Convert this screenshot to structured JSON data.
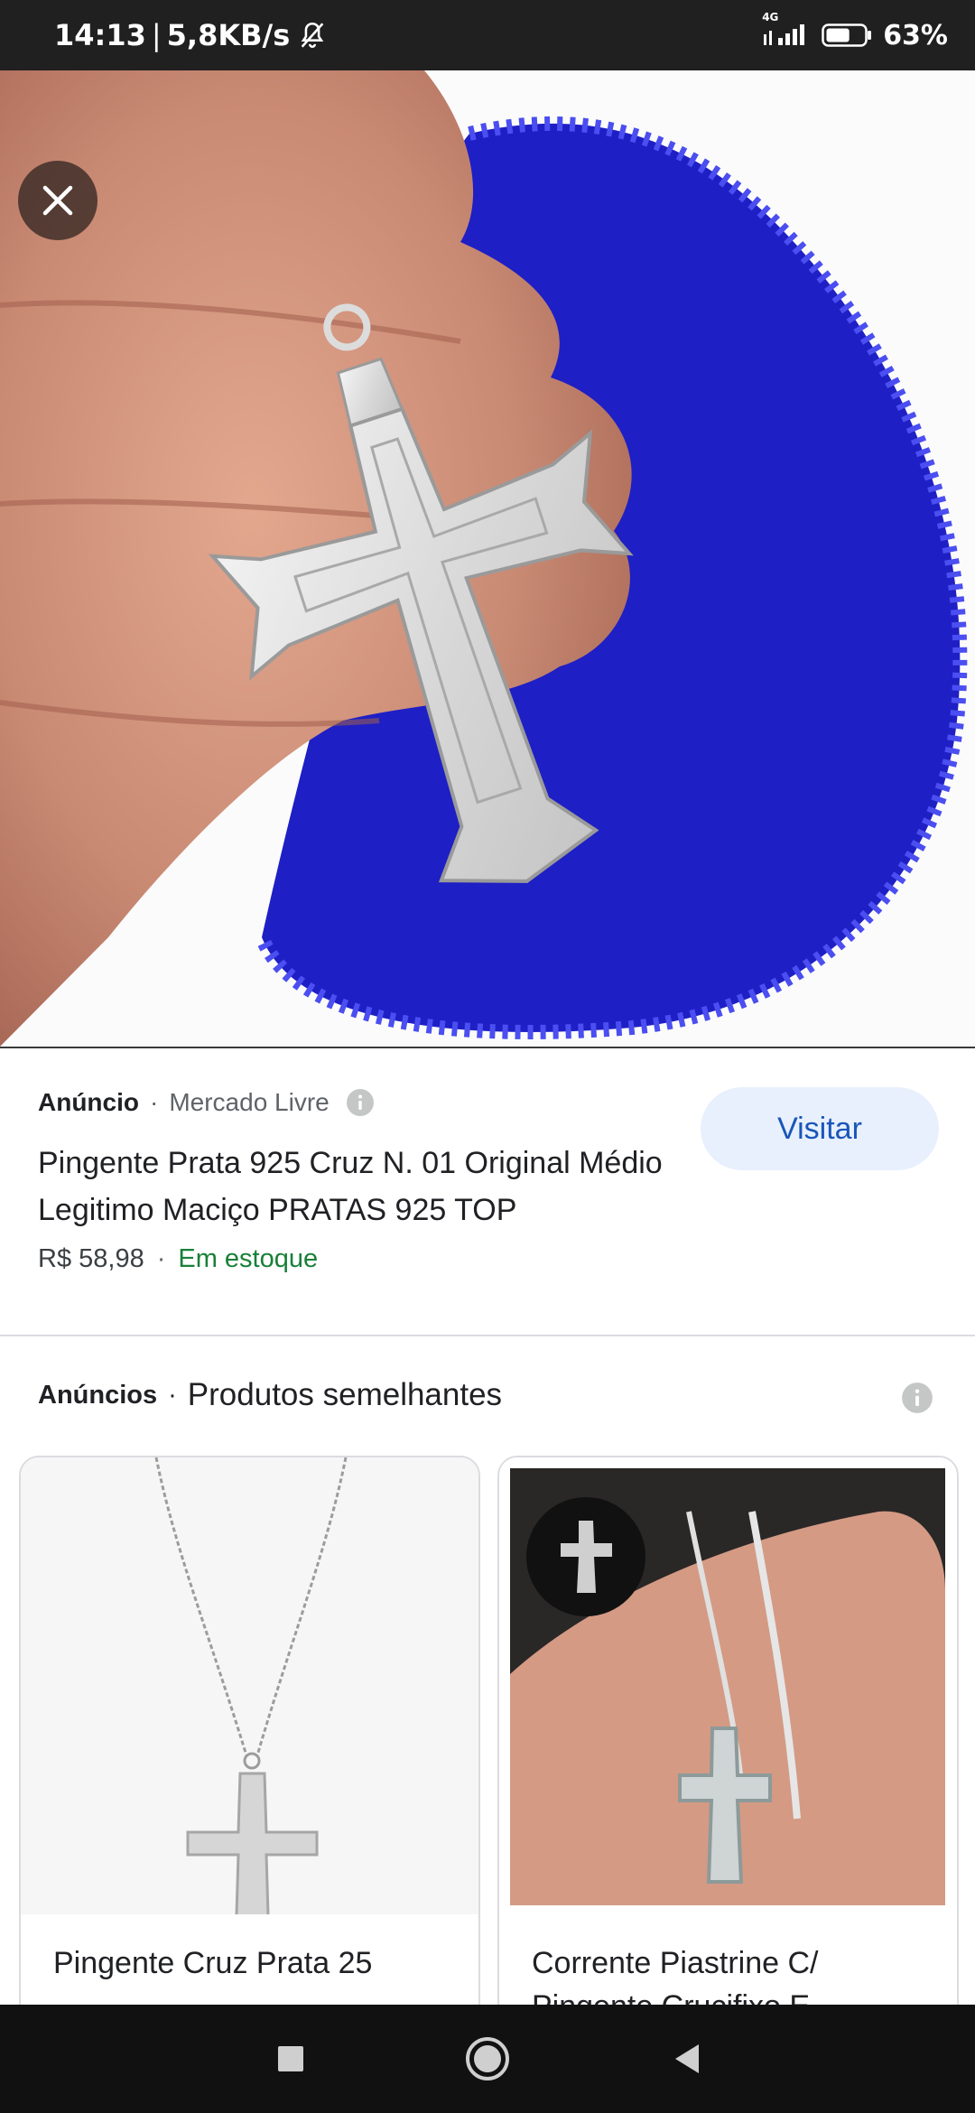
{
  "status_bar": {
    "time": "14:13",
    "separator": "|",
    "speed": "5,8KB/s",
    "network_type": "4G",
    "battery_percent": "63%",
    "battery_level": 0.63,
    "icons": [
      "bell-off-icon",
      "signal-icon",
      "battery-icon"
    ]
  },
  "hero": {
    "close_icon": "close-icon",
    "image_subject": "silver cross pendant on hand with blue velvet pouch"
  },
  "ad": {
    "label": "Anúncio",
    "dot": "·",
    "store": "Mercado Livre",
    "title": "Pingente Prata 925 Cruz N. 01 Original Médio Legitimo Maciço PRATAS 925 TOP",
    "price": "R$ 58,98",
    "stock": "Em estoque",
    "visit_label": "Visitar"
  },
  "similar": {
    "ads_label": "Anúncios",
    "dot": "·",
    "title": "Produtos semelhantes",
    "items": [
      {
        "title": "Pingente Cruz Prata 25"
      },
      {
        "title": "Corrente Piastrine C/ Pingente Crucifixo E"
      }
    ]
  },
  "nav": {
    "icons": [
      "recents-square-icon",
      "home-circle-icon",
      "back-triangle-icon"
    ]
  },
  "colors": {
    "status_bg": "#202020",
    "nav_bg": "#111111",
    "stock_green": "#188038",
    "visit_bg": "#e8f0fe",
    "visit_text": "#1a56b8",
    "pouch_blue": "#1e1fc4"
  }
}
